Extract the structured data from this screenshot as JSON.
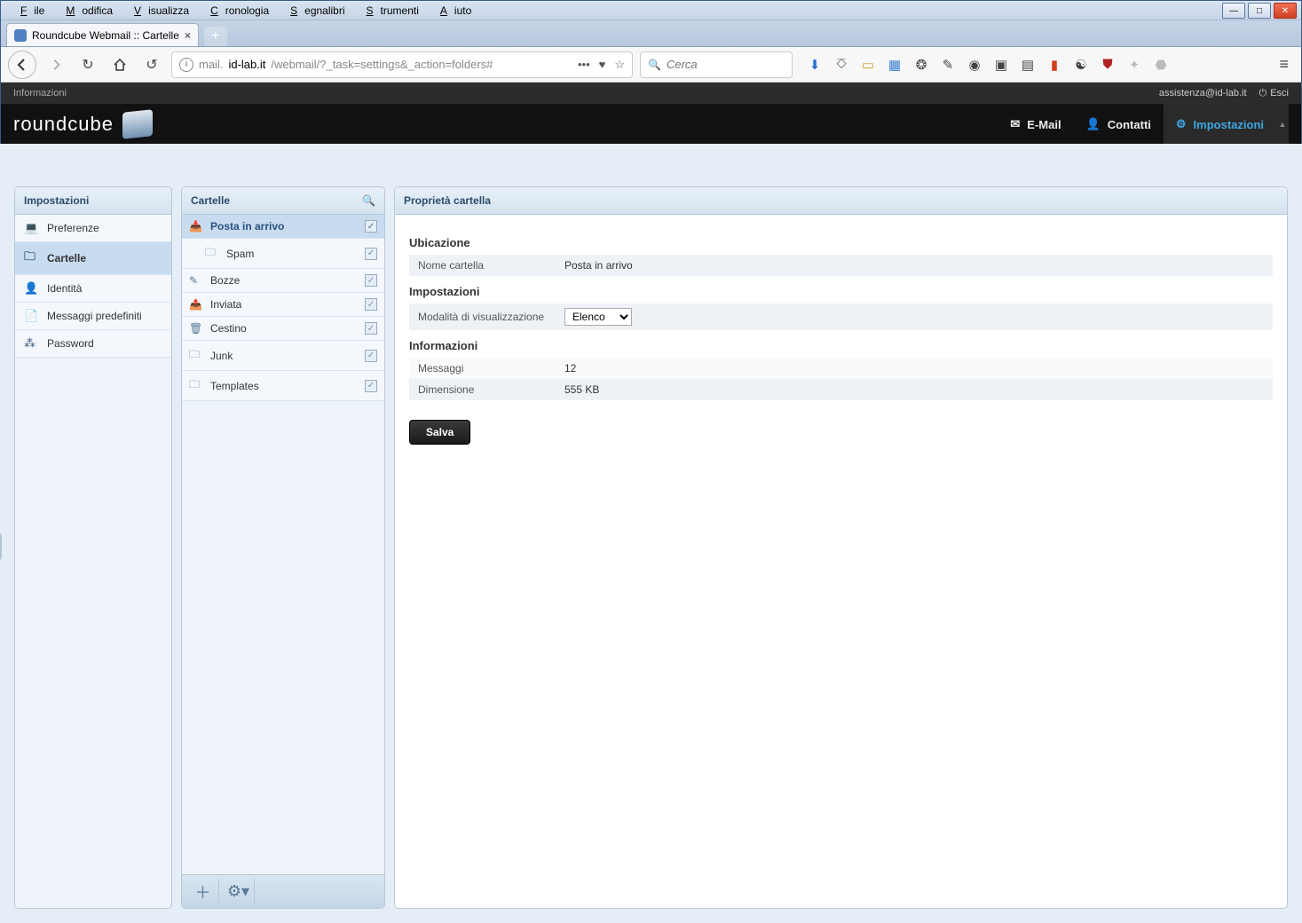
{
  "browser": {
    "menus": [
      "File",
      "Modifica",
      "Visualizza",
      "Cronologia",
      "Segnalibri",
      "Strumenti",
      "Aiuto"
    ],
    "tab_title": "Roundcube Webmail :: Cartelle",
    "url_prefix": "mail.",
    "url_domain": "id-lab.it",
    "url_path": "/webmail/?_task=settings&_action=folders#",
    "search_placeholder": "Cerca"
  },
  "rc": {
    "info_label": "Informazioni",
    "user_email": "assistenza@id-lab.it",
    "logout": "Esci",
    "logo_text": "roundcube",
    "nav": {
      "mail": "E-Mail",
      "contacts": "Contatti",
      "settings": "Impostazioni"
    }
  },
  "settings": {
    "header": "Impostazioni",
    "items": [
      {
        "label": "Preferenze"
      },
      {
        "label": "Cartelle"
      },
      {
        "label": "Identità"
      },
      {
        "label": "Messaggi predefiniti"
      },
      {
        "label": "Password"
      }
    ]
  },
  "folders": {
    "header": "Cartelle",
    "items": [
      {
        "label": "Posta in arrivo"
      },
      {
        "label": "Spam"
      },
      {
        "label": "Bozze"
      },
      {
        "label": "Inviata"
      },
      {
        "label": "Cestino"
      },
      {
        "label": "Junk"
      },
      {
        "label": "Templates"
      }
    ]
  },
  "props": {
    "header": "Proprietà cartella",
    "ubicazione_title": "Ubicazione",
    "nome_label": "Nome cartella",
    "nome_value": "Posta in arrivo",
    "impostazioni_title": "Impostazioni",
    "viewmode_label": "Modalità di visualizzazione",
    "viewmode_value": "Elenco",
    "info_title": "Informazioni",
    "messages_label": "Messaggi",
    "messages_value": "12",
    "size_label": "Dimensione",
    "size_value": "555 KB",
    "save": "Salva"
  }
}
